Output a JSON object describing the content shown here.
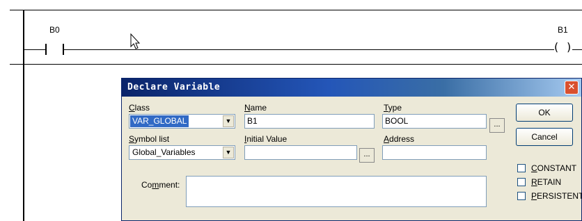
{
  "ladder": {
    "contact_label": "B0",
    "coil_label": "B1"
  },
  "dialog": {
    "title": "Declare Variable",
    "class": {
      "label_access": "C",
      "label_rest": "lass",
      "value": "VAR_GLOBAL"
    },
    "name": {
      "label_access": "N",
      "label_rest": "ame",
      "value": "B1"
    },
    "type": {
      "label_access": "T",
      "label_rest": "ype",
      "value": "BOOL"
    },
    "symbol_list": {
      "label_access": "S",
      "label_rest": "ymbol list",
      "value": "Global_Variables"
    },
    "initial_value": {
      "label_access": "I",
      "label_rest": "nitial Value",
      "value": ""
    },
    "address": {
      "label_access": "A",
      "label_rest": "ddress",
      "value": ""
    },
    "comment": {
      "label_pre": "Co",
      "label_access": "m",
      "label_rest": "ment:",
      "value": ""
    },
    "browse_label": "...",
    "ok_label": "OK",
    "cancel_label": "Cancel",
    "checkboxes": [
      {
        "access": "C",
        "rest": "ONSTANT",
        "checked": false
      },
      {
        "access": "R",
        "rest": "ETAIN",
        "checked": false
      },
      {
        "access": "P",
        "rest": "ERSISTENT",
        "checked": false
      }
    ]
  }
}
